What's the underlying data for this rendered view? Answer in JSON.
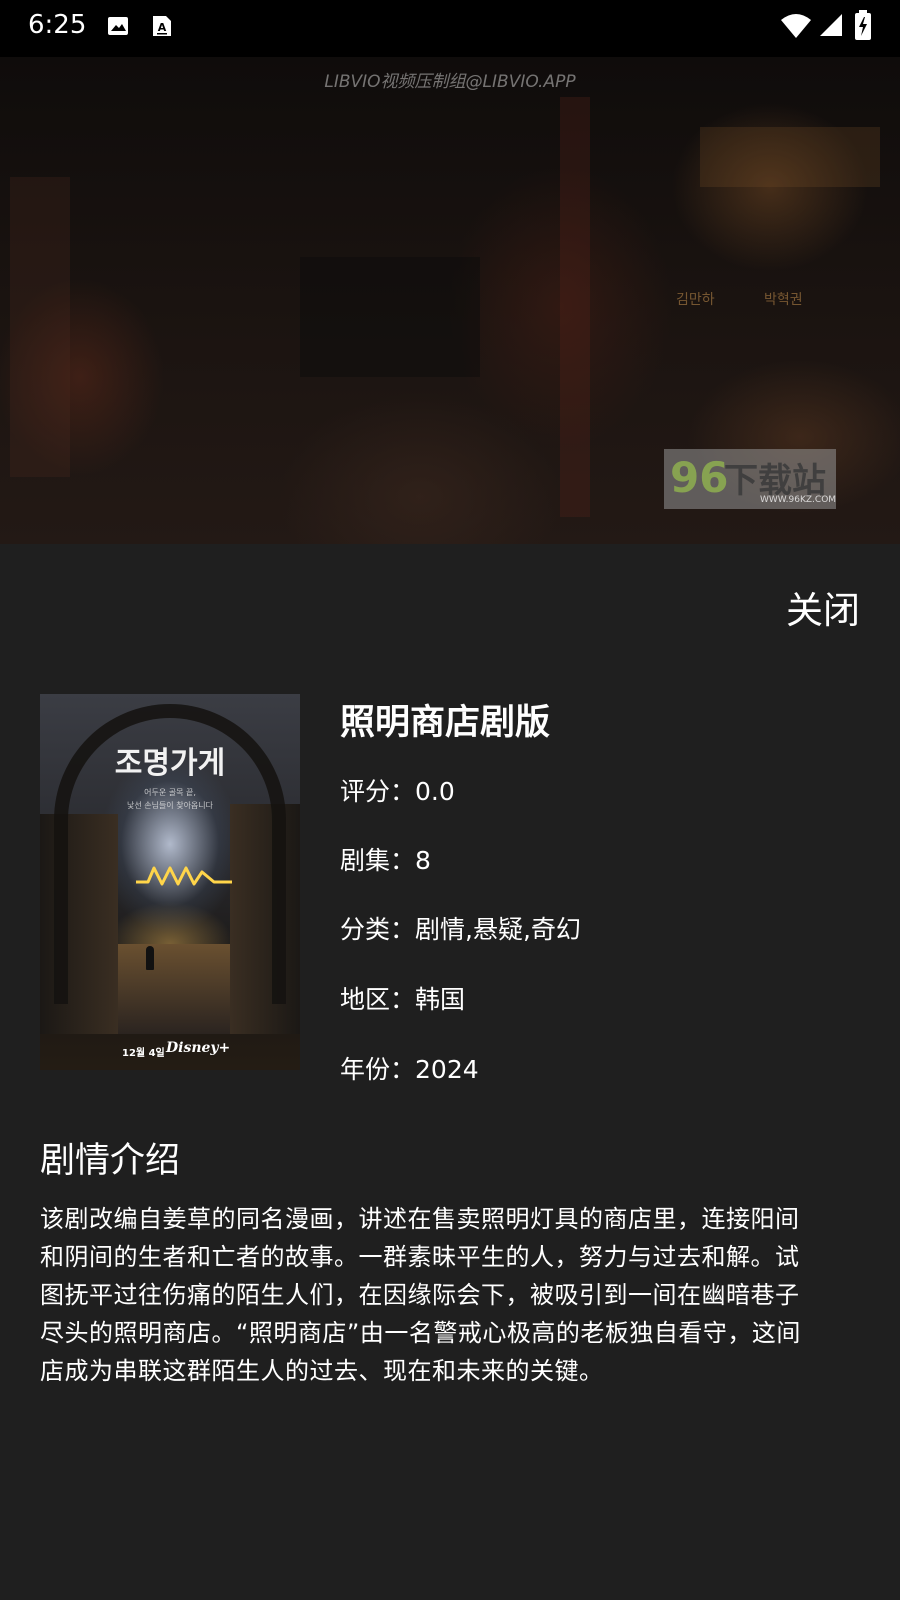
{
  "status_bar": {
    "time": "6:25",
    "left_icons": [
      "image-icon",
      "a-text-icon"
    ],
    "right_icons": [
      "wifi-icon",
      "cellular-signal-icon",
      "battery-charging-icon"
    ]
  },
  "video": {
    "watermark": "LIBVIO视频压制组@LIBVIO.APP",
    "subtitles": [
      "김만하",
      "박혁권"
    ],
    "site_logo": {
      "number": "96",
      "name": "下载站",
      "url": "WWW.96KZ.COM"
    }
  },
  "close_label": "关闭",
  "poster": {
    "title": "조명가게",
    "tagline_line1": "어두운 골목 끝,",
    "tagline_line2": "낯선 손님들이 찾아옵니다",
    "date": "12월 4일",
    "brand": "Disney+"
  },
  "show": {
    "title": "照明商店剧版",
    "fields": [
      {
        "label": "评分：",
        "value": "0.0"
      },
      {
        "label": "剧集：",
        "value": "8"
      },
      {
        "label": "分类：",
        "value": "剧情,悬疑,奇幻"
      },
      {
        "label": "地区：",
        "value": "韩国"
      },
      {
        "label": "年份：",
        "value": "2024"
      }
    ]
  },
  "synopsis": {
    "heading": "剧情介绍",
    "lines": [
      "该剧改编自姜草的同名漫画，讲述在售卖照明灯具的商店里，连接阳间",
      "和阴间的生者和亡者的故事。一群素昧平生的人，努力与过去和解。试",
      "图抚平过往伤痛的陌生人们，在因缘际会下，被吸引到一间在幽暗巷子",
      "尽头的照明商店。“照明商店”由一名警戒心极高的老板独自看守，这间",
      "店成为串联这群陌生人的过去、现在和未来的关键。"
    ]
  },
  "colors": {
    "background": "#1f1f1f",
    "status_bar": "#000000",
    "text": "#ffffff"
  }
}
